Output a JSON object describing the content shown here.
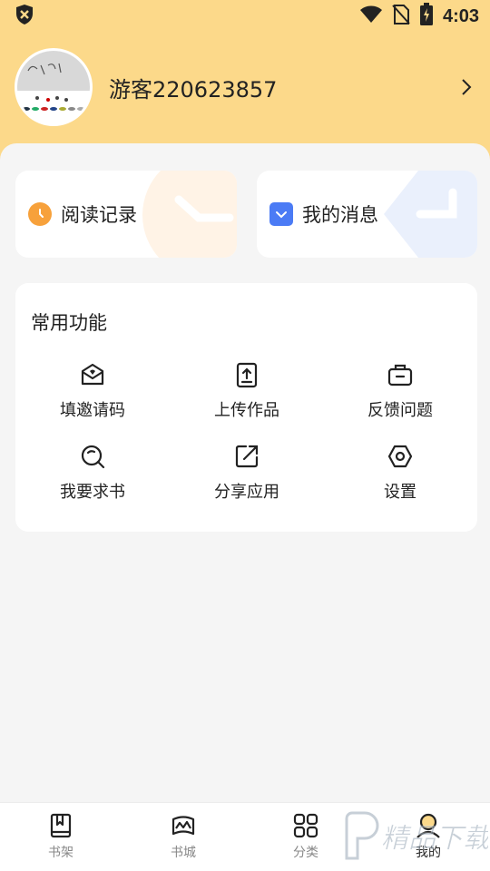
{
  "status_bar": {
    "time": "4:03"
  },
  "profile": {
    "username": "游客220623857"
  },
  "quick_cards": [
    {
      "label": "阅读记录",
      "icon": "clock-icon",
      "accent": "#f7a13b"
    },
    {
      "label": "我的消息",
      "icon": "message-icon",
      "accent": "#4b7bf5"
    }
  ],
  "features": {
    "title": "常用功能",
    "items": [
      {
        "label": "填邀请码",
        "icon": "invite-envelope-icon"
      },
      {
        "label": "上传作品",
        "icon": "upload-icon"
      },
      {
        "label": "反馈问题",
        "icon": "feedback-briefcase-icon"
      },
      {
        "label": "我要求书",
        "icon": "search-request-icon"
      },
      {
        "label": "分享应用",
        "icon": "share-icon"
      },
      {
        "label": "设置",
        "icon": "settings-hexagon-icon"
      }
    ]
  },
  "bottom_nav": [
    {
      "label": "书架",
      "icon": "bookshelf-icon",
      "active": false
    },
    {
      "label": "书城",
      "icon": "bookstore-icon",
      "active": false
    },
    {
      "label": "分类",
      "icon": "category-grid-icon",
      "active": false
    },
    {
      "label": "我的",
      "icon": "profile-icon",
      "active": true
    }
  ],
  "watermark": {
    "text": "精品下载"
  },
  "colors": {
    "header": "#fcd98a",
    "background": "#f5f5f5",
    "clock_accent": "#f7a13b",
    "message_accent": "#4b7bf5"
  }
}
